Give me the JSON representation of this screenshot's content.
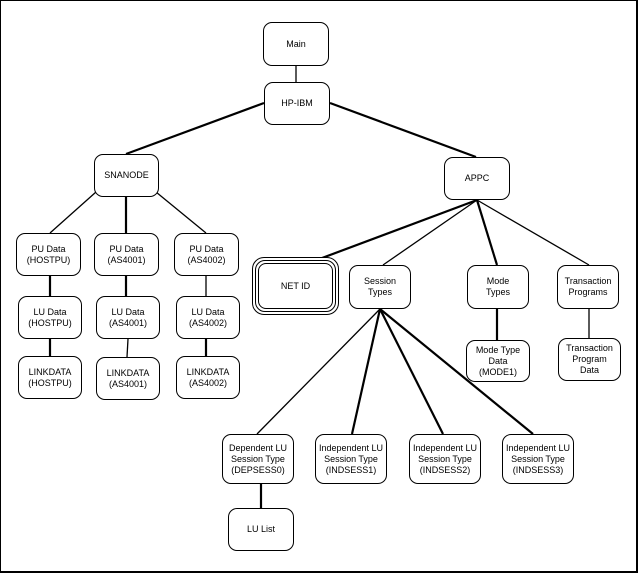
{
  "diagram": {
    "type": "tree",
    "nodes": [
      {
        "id": "main",
        "label": "Main"
      },
      {
        "id": "hpibm",
        "label": "HP-IBM"
      },
      {
        "id": "snanode",
        "label": "SNANODE"
      },
      {
        "id": "appc",
        "label": "APPC"
      },
      {
        "id": "pu_hostpu",
        "label": "PU Data\n(HOSTPU)"
      },
      {
        "id": "pu_as4001",
        "label": "PU Data\n(AS4001)"
      },
      {
        "id": "pu_as4002",
        "label": "PU Data\n(AS4002)"
      },
      {
        "id": "lu_hostpu",
        "label": "LU Data\n(HOSTPU)"
      },
      {
        "id": "lu_as4001",
        "label": "LU Data\n(AS4001)"
      },
      {
        "id": "lu_as4002",
        "label": "LU Data\n(AS4002)"
      },
      {
        "id": "link_hostpu",
        "label": "LINKDATA\n(HOSTPU)"
      },
      {
        "id": "link_as4001",
        "label": "LINKDATA\n(AS4001)"
      },
      {
        "id": "link_as4002",
        "label": "LINKDATA\n(AS4002)"
      },
      {
        "id": "netid",
        "label": "NET ID",
        "style": "triple-border"
      },
      {
        "id": "session_types",
        "label": "Session\nTypes"
      },
      {
        "id": "mode_types",
        "label": "Mode\nTypes"
      },
      {
        "id": "tp",
        "label": "Transaction\nPrograms"
      },
      {
        "id": "mode_data",
        "label": "Mode Type\nData\n(MODE1)"
      },
      {
        "id": "tp_data",
        "label": "Transaction\nProgram\nData"
      },
      {
        "id": "dep_sess0",
        "label": "Dependent LU\nSession Type\n(DEPSESS0)"
      },
      {
        "id": "ind_sess1",
        "label": "Independent LU\nSession Type\n(INDSESS1)"
      },
      {
        "id": "ind_sess2",
        "label": "Independent LU\nSession Type\n(INDSESS2)"
      },
      {
        "id": "ind_sess3",
        "label": "Independent LU\nSession Type\n(INDSESS3)"
      },
      {
        "id": "lu_list",
        "label": "LU List"
      }
    ],
    "edges": [
      {
        "from": "main",
        "to": "hpibm"
      },
      {
        "from": "hpibm",
        "to": "snanode",
        "weight": "thick"
      },
      {
        "from": "hpibm",
        "to": "appc",
        "weight": "thick"
      },
      {
        "from": "snanode",
        "to": "pu_hostpu"
      },
      {
        "from": "snanode",
        "to": "pu_as4001",
        "weight": "thick"
      },
      {
        "from": "snanode",
        "to": "pu_as4002"
      },
      {
        "from": "pu_hostpu",
        "to": "lu_hostpu",
        "weight": "thick"
      },
      {
        "from": "pu_as4001",
        "to": "lu_as4001",
        "weight": "thick"
      },
      {
        "from": "pu_as4002",
        "to": "lu_as4002"
      },
      {
        "from": "lu_hostpu",
        "to": "link_hostpu",
        "weight": "thick"
      },
      {
        "from": "lu_as4001",
        "to": "link_as4001"
      },
      {
        "from": "lu_as4002",
        "to": "link_as4002",
        "weight": "thick"
      },
      {
        "from": "appc",
        "to": "netid",
        "weight": "thick"
      },
      {
        "from": "appc",
        "to": "session_types"
      },
      {
        "from": "appc",
        "to": "mode_types",
        "weight": "thick"
      },
      {
        "from": "appc",
        "to": "tp"
      },
      {
        "from": "mode_types",
        "to": "mode_data",
        "weight": "thick"
      },
      {
        "from": "tp",
        "to": "tp_data"
      },
      {
        "from": "session_types",
        "to": "dep_sess0"
      },
      {
        "from": "session_types",
        "to": "ind_sess1",
        "weight": "thick"
      },
      {
        "from": "session_types",
        "to": "ind_sess2",
        "weight": "thick"
      },
      {
        "from": "session_types",
        "to": "ind_sess3",
        "weight": "thick"
      },
      {
        "from": "dep_sess0",
        "to": "lu_list",
        "weight": "thick"
      }
    ]
  }
}
